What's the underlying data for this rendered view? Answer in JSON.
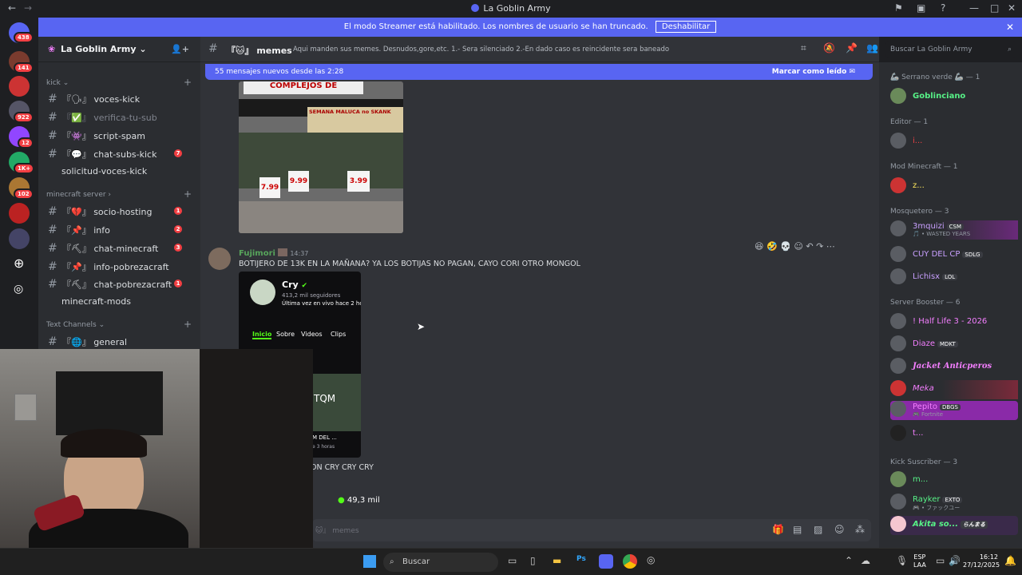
{
  "window": {
    "title": "La Goblin Army"
  },
  "banner": {
    "text": "El modo Streamer está habilitado. Los nombres de usuario se han truncado.",
    "button": "Deshabilitar"
  },
  "servers": {
    "badges": [
      "438",
      "141",
      "922",
      "12",
      "1K+",
      "102"
    ]
  },
  "sidebar": {
    "server_name": "La Goblin Army",
    "sections": [
      {
        "name": "kick",
        "channels": [
          {
            "prefix": "『🗣』",
            "name": "voces-kick",
            "badge": ""
          },
          {
            "prefix": "『✅』",
            "name": "verifica-tu-sub",
            "badge": ""
          },
          {
            "prefix": "『👾』",
            "name": "script-spam",
            "badge": ""
          },
          {
            "prefix": "『💬』",
            "name": "chat-subs-kick",
            "badge": "7"
          },
          {
            "prefix": "",
            "name": "solicitud-voces-kick",
            "badge": ""
          }
        ]
      },
      {
        "name": "minecraft server",
        "channels": [
          {
            "prefix": "『💔』",
            "name": "socio-hosting",
            "badge": "1"
          },
          {
            "prefix": "『📌』",
            "name": "info",
            "badge": "2"
          },
          {
            "prefix": "『⛏』",
            "name": "chat-minecraft",
            "badge": "3"
          },
          {
            "prefix": "『📌』",
            "name": "info-pobrezacraft",
            "badge": ""
          },
          {
            "prefix": "『⛏』",
            "name": "chat-pobrezacraft",
            "badge": "1"
          },
          {
            "prefix": "",
            "name": "minecraft-mods",
            "badge": ""
          }
        ]
      },
      {
        "name": "Text Channels",
        "channels": [
          {
            "prefix": "『🌐』",
            "name": "general",
            "badge": ""
          }
        ]
      }
    ]
  },
  "channel": {
    "prefix": "『🐱』",
    "name": "memes",
    "topic": "Aqui manden sus memes. Desnudos,gore,etc. 1.- Sera silenciado 2.-En dado caso es reincidente sera baneado",
    "search_placeholder": "Buscar La Goblin Army"
  },
  "new_messages": {
    "text": "55 mensajes nuevos desde las 2:28",
    "action": "Marcar como leído"
  },
  "image1": {
    "sign_top": "COMPLEJOS DE",
    "sign_store": "SEMANA MALUCA no SKANK",
    "price1": "7.99",
    "price2": "9.99",
    "price3": "3.99"
  },
  "message": {
    "author": "Fujimori",
    "time": "14:37",
    "text": "BOTIJERO DE 13K EN LA MAÑANA? YA LOS BOTIJAS NO PAGAN, CAYO CORI OTRO MONGOL",
    "embed": {
      "name": "Cry",
      "followers": "413,2 mil seguidores",
      "last_live": "Última vez en vivo hace 2 ho",
      "tabs": [
        "Inicio",
        "Sobre",
        "Videos",
        "Clips"
      ],
      "thumb_text": "TQM",
      "video_title": "M DEL ...",
      "video_time": "e 3 horas"
    },
    "caption": "ON CRY CRY CRY",
    "viewers": "49,3 mil"
  },
  "composer": {
    "placeholder": "memes"
  },
  "members": {
    "groups": [
      {
        "name": "🦾 Serrano verde 🦾 — 1",
        "members": [
          {
            "name": "Goblinciano",
            "color": "#57f287",
            "tag": "",
            "sub": ""
          }
        ]
      },
      {
        "name": "Editor — 1",
        "members": [
          {
            "name": "i...",
            "color": "#ed4245",
            "tag": "",
            "sub": ""
          }
        ]
      },
      {
        "name": "Mod Minecraft — 1",
        "members": [
          {
            "name": "z...",
            "color": "#fee75c",
            "tag": "",
            "sub": ""
          }
        ]
      },
      {
        "name": "Mosquetero — 3",
        "members": [
          {
            "name": "3mquizi",
            "color": "#c9a0ff",
            "tag": "CSM",
            "sub": "🎵 • WASTED YEARS"
          },
          {
            "name": "CUY DEL CP",
            "color": "#c9a0ff",
            "tag": "SDLG",
            "sub": ""
          },
          {
            "name": "Lichisx",
            "color": "#c9a0ff",
            "tag": "LOL",
            "sub": ""
          }
        ]
      },
      {
        "name": "Server Booster — 6",
        "members": [
          {
            "name": "! Half Life 3 - 2026",
            "color": "#f47fff",
            "tag": "",
            "sub": ""
          },
          {
            "name": "Diaze",
            "color": "#f47fff",
            "tag": "MDKT",
            "sub": ""
          },
          {
            "name": "Jacket Anticperos",
            "color": "#f47fff",
            "tag": "",
            "sub": ""
          },
          {
            "name": "Meka",
            "color": "#f47fff",
            "tag": "",
            "sub": ""
          },
          {
            "name": "Pepito",
            "color": "#f47fff",
            "tag": "DBGS",
            "sub": "🎮 Fortnite"
          },
          {
            "name": "t...",
            "color": "#f47fff",
            "tag": "",
            "sub": ""
          }
        ]
      },
      {
        "name": "Kick Suscriber — 3",
        "members": [
          {
            "name": "m...",
            "color": "#57f287",
            "tag": "",
            "sub": ""
          },
          {
            "name": "Rayker",
            "color": "#57f287",
            "tag": "EXTO",
            "sub": "🎮 • ファックユー"
          },
          {
            "name": "Akita so...",
            "color": "#57f287",
            "tag": "らんまる",
            "sub": ""
          }
        ]
      }
    ]
  },
  "taskbar": {
    "search": "Buscar",
    "lang1": "ESP",
    "lang2": "LAA",
    "time": "16:12",
    "date": "27/12/2025"
  }
}
